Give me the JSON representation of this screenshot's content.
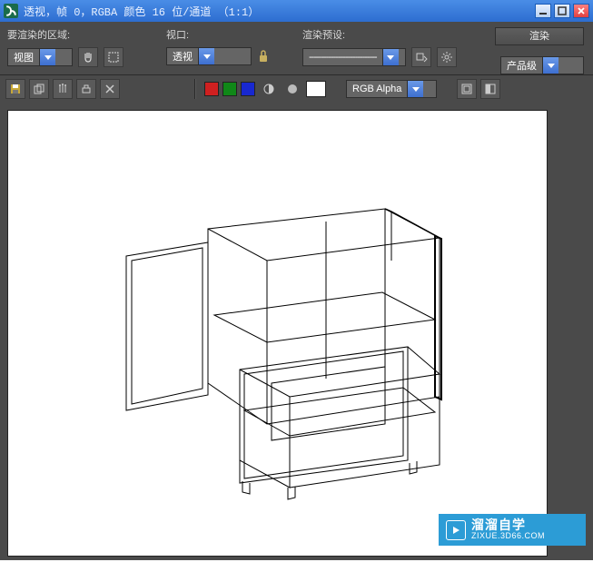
{
  "titlebar": {
    "title": "透视，帧 0，RGBA 颜色 16 位/通道 （1:1）"
  },
  "labels": {
    "area": "要渲染的区域:",
    "viewport": "视口:",
    "preset": "渲染预设:"
  },
  "buttons": {
    "render": "渲染"
  },
  "combos": {
    "area": "视图",
    "viewport": "透视",
    "preset": "----------------------------",
    "quality": "产品级",
    "channel": "RGB Alpha"
  },
  "swatches": {
    "red": "#d02020",
    "green": "#108818",
    "blue": "#1828d0",
    "bg": "#ffffff"
  },
  "watermark": {
    "title": "溜溜自学",
    "url": "ZIXUE.3D66.COM"
  }
}
